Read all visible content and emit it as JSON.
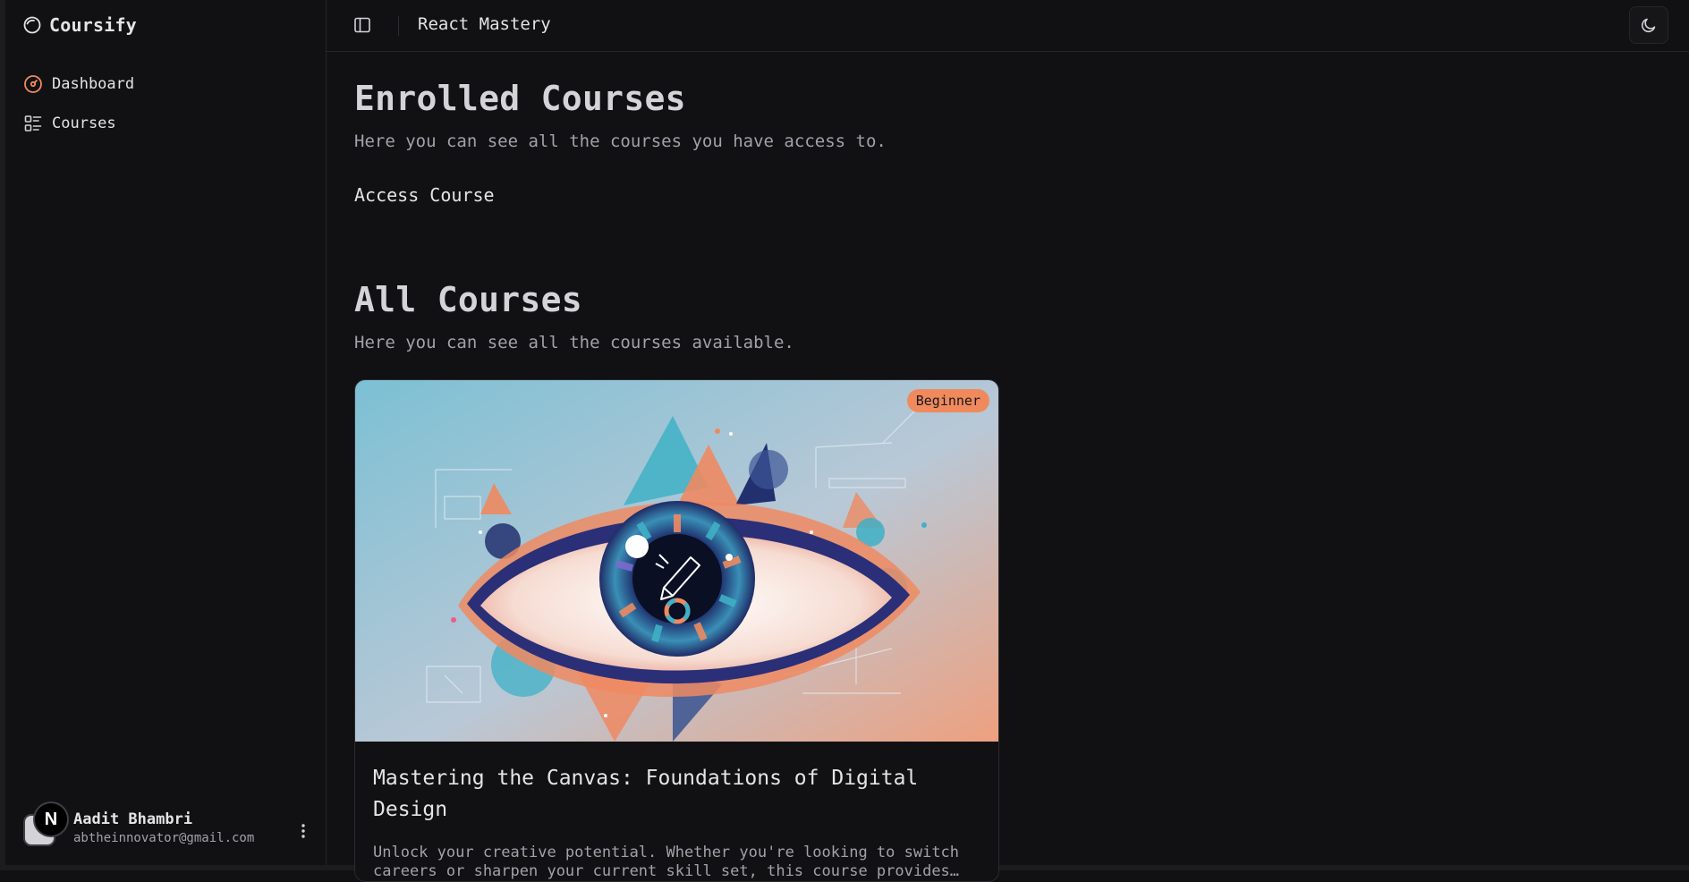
{
  "app": {
    "name": "Coursify"
  },
  "sidebar": {
    "items": [
      {
        "label": "Dashboard",
        "icon": "gauge-icon"
      },
      {
        "label": "Courses",
        "icon": "list-icon"
      }
    ],
    "user": {
      "initial": "N",
      "name": "Aadit Bhambri",
      "email": "abtheinnovator@gmail.com"
    }
  },
  "header": {
    "title": "React Mastery"
  },
  "enrolled": {
    "heading": "Enrolled Courses",
    "description": "Here you can see all the courses you have access to.",
    "access_label": "Access Course"
  },
  "all_courses": {
    "heading": "All Courses",
    "description": "Here you can see all the courses available.",
    "courses": [
      {
        "badge": "Beginner",
        "title": "Mastering the Canvas: Foundations of Digital Design",
        "description": "Unlock your creative potential. Whether you're looking to switch careers or sharpen your current skill set, this course provides…"
      }
    ]
  },
  "colors": {
    "accent": "#f08a5d",
    "background": "#111113",
    "text": "#e4e4e7",
    "muted": "#a1a1aa",
    "border": "#26262a"
  }
}
